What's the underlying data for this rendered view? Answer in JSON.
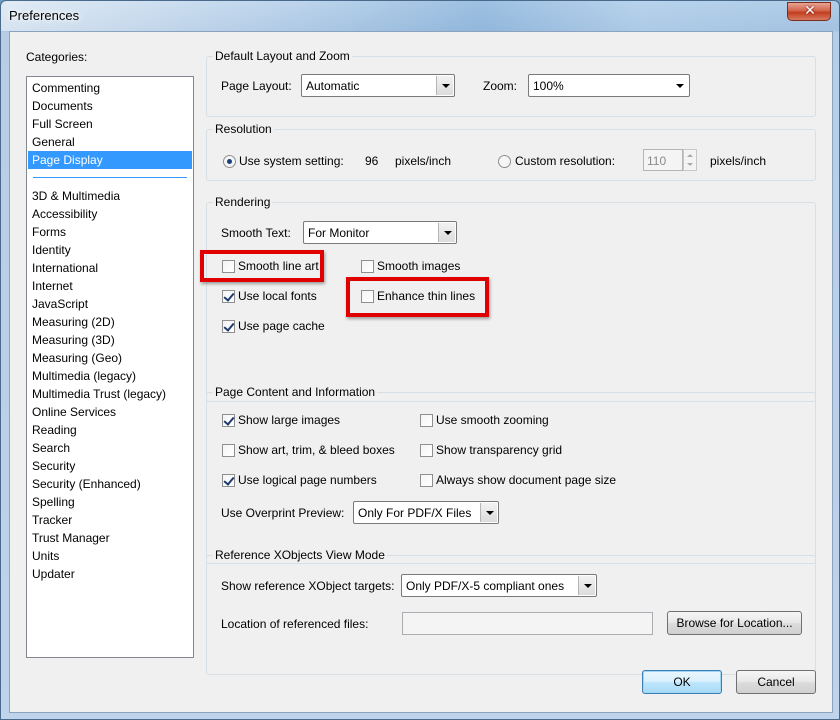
{
  "window": {
    "title": "Preferences",
    "close_glyph": "✕"
  },
  "categories": {
    "label": "Categories:",
    "top_items": [
      "Commenting",
      "Documents",
      "Full Screen",
      "General",
      "Page Display"
    ],
    "bottom_items": [
      "3D & Multimedia",
      "Accessibility",
      "Forms",
      "Identity",
      "International",
      "Internet",
      "JavaScript",
      "Measuring (2D)",
      "Measuring (3D)",
      "Measuring (Geo)",
      "Multimedia (legacy)",
      "Multimedia Trust (legacy)",
      "Online Services",
      "Reading",
      "Search",
      "Security",
      "Security (Enhanced)",
      "Spelling",
      "Tracker",
      "Trust Manager",
      "Units",
      "Updater"
    ],
    "selected": "Page Display"
  },
  "layout_zoom": {
    "title": "Default Layout and Zoom",
    "page_layout_label": "Page Layout:",
    "page_layout_value": "Automatic",
    "zoom_label": "Zoom:",
    "zoom_value": "100%"
  },
  "resolution": {
    "title": "Resolution",
    "system_label": "Use system setting:",
    "system_value": "96",
    "system_unit": "pixels/inch",
    "system_selected": true,
    "custom_label": "Custom resolution:",
    "custom_value": "110",
    "custom_unit": "pixels/inch"
  },
  "rendering": {
    "title": "Rendering",
    "smooth_text_label": "Smooth Text:",
    "smooth_text_value": "For Monitor",
    "smooth_line_art": {
      "label": "Smooth line art",
      "checked": false
    },
    "smooth_images": {
      "label": "Smooth images",
      "checked": false
    },
    "use_local_fonts": {
      "label": "Use local fonts",
      "checked": true
    },
    "enhance_thin_lines": {
      "label": "Enhance thin lines",
      "checked": false
    },
    "use_page_cache": {
      "label": "Use page cache",
      "checked": true
    }
  },
  "page_content": {
    "title": "Page Content and Information",
    "show_large_images": {
      "label": "Show large images",
      "checked": true
    },
    "use_smooth_zooming": {
      "label": "Use smooth zooming",
      "checked": false
    },
    "show_boxes": {
      "label": "Show art, trim, & bleed boxes",
      "checked": false
    },
    "show_transparency_grid": {
      "label": "Show transparency grid",
      "checked": false
    },
    "use_logical_page_numbers": {
      "label": "Use logical page numbers",
      "checked": true
    },
    "always_show_page_size": {
      "label": "Always show document page size",
      "checked": false
    },
    "overprint_label": "Use Overprint Preview:",
    "overprint_value": "Only For PDF/X Files"
  },
  "xobjects": {
    "title": "Reference XObjects View Mode",
    "targets_label": "Show reference XObject targets:",
    "targets_value": "Only PDF/X-5 compliant ones",
    "location_label": "Location of referenced files:",
    "location_value": "",
    "browse_label": "Browse for Location..."
  },
  "footer": {
    "ok_label": "OK",
    "cancel_label": "Cancel"
  },
  "highlight_color": "#e00000",
  "selection_color": "#3399ff"
}
